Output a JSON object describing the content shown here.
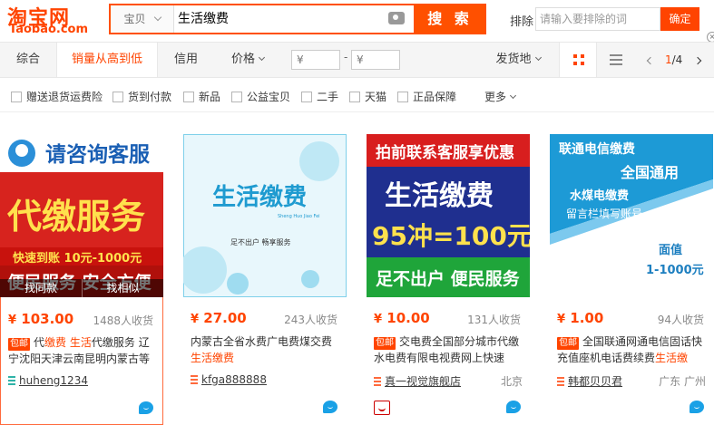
{
  "header": {
    "logo_cn": "淘宝网",
    "logo_en": "Taobao.com",
    "search_category": "宝贝",
    "search_query": "生活缴费",
    "search_button": "搜 索",
    "exclude_label": "排除",
    "exclude_placeholder": "请输入要排除的词",
    "exclude_button": "确定",
    "close_glyph": "×"
  },
  "sortbar": {
    "items": [
      "综合",
      "销量从高到低",
      "信用",
      "价格"
    ],
    "active_index": 1,
    "price_from_symbol": "¥",
    "price_to_symbol": "¥",
    "price_dash": "-",
    "ship_from": "发货地",
    "page_current": "1",
    "page_total": "/4"
  },
  "filters": {
    "items": [
      "赠送退货运费险",
      "货到付款",
      "新品",
      "公益宝贝",
      "二手",
      "天猫",
      "正品保障"
    ],
    "more": "更多"
  },
  "colors": {
    "brand": "#ff4400",
    "search_border": "#ff5000"
  },
  "products": [
    {
      "img_top": "请咨询客服",
      "img_main": "代缴服务",
      "img_sub": "快速到账  10元-1000元",
      "img_bottom": "便民服务 安全方便",
      "hover_left": "找同款",
      "hover_right": "找相似",
      "price_symbol": "¥",
      "price": "103.00",
      "sold": "1488人收货",
      "baoyou": "包邮",
      "title_pre": "代",
      "title_hi1": "缴费",
      "title_mid": " ",
      "title_hi2": "生活",
      "title_post": "代缴服务 辽宁沈阳天津云南昆明内蒙古等",
      "shop": "huheng1234",
      "location": ""
    },
    {
      "img_main": "生活缴费",
      "img_small": "Sheng Huo Jiao Fei",
      "img_sub": "足不出户  畅享服务",
      "price_symbol": "¥",
      "price": "27.00",
      "sold": "243人收货",
      "baoyou": "",
      "title_pre": "内蒙古全省水费广电费煤交费 ",
      "title_hi1": "生活缴费",
      "title_mid": "",
      "title_hi2": "",
      "title_post": "",
      "shop": "kfga888888",
      "location": ""
    },
    {
      "img_top": "拍前联系客服享优惠",
      "img_main": "生活缴费",
      "img_promo": "95冲=100元",
      "img_bottom": "足不出户 便民服务",
      "price_symbol": "¥",
      "price": "10.00",
      "sold": "131人收货",
      "baoyou": "包邮",
      "title_pre": "交电费全国部分城市代缴水电费有限电视费网上快速",
      "title_hi1": "",
      "title_mid": "",
      "title_hi2": "",
      "title_post": "",
      "shop": "真一视觉旗舰店",
      "location": "北京"
    },
    {
      "img_top": "联通电信缴费",
      "img_main": "全国通用",
      "img_sub1": "水煤电缴费",
      "img_sub2": "留言栏填写账号",
      "img_face": "面值",
      "img_range": "1-1000元",
      "price_symbol": "¥",
      "price": "1.00",
      "sold": "94人收货",
      "baoyou": "包邮",
      "title_pre": "全国联通网通电信固话快充值座机电话费续费",
      "title_hi1": "生活缴",
      "title_mid": "",
      "title_hi2": "",
      "title_post": "",
      "shop": "韩都贝贝君",
      "location": "广东 广州"
    }
  ]
}
